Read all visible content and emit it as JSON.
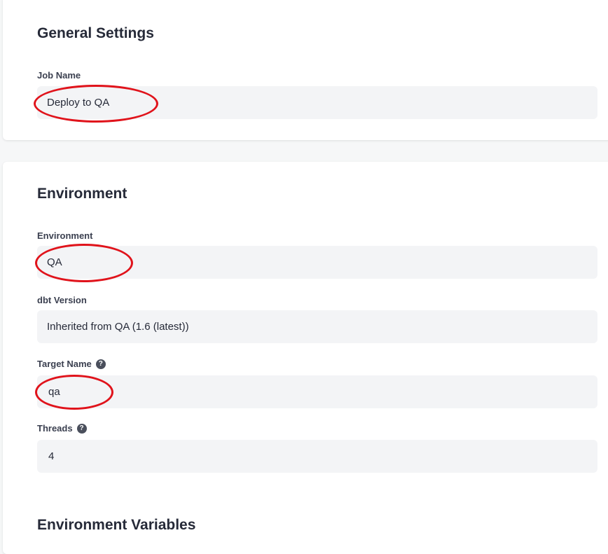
{
  "general": {
    "title": "General Settings",
    "job_name_label": "Job Name",
    "job_name_value": "Deploy to QA"
  },
  "environment": {
    "title": "Environment",
    "environment_label": "Environment",
    "environment_value": "QA",
    "dbt_version_label": "dbt Version",
    "dbt_version_value": "Inherited from QA (1.6 (latest))",
    "target_name_label": "Target Name",
    "target_name_value": "qa",
    "threads_label": "Threads",
    "threads_value": "4",
    "help_icon_glyph": "?"
  },
  "env_vars": {
    "title": "Environment Variables"
  },
  "annotation_color": "#e0131b"
}
